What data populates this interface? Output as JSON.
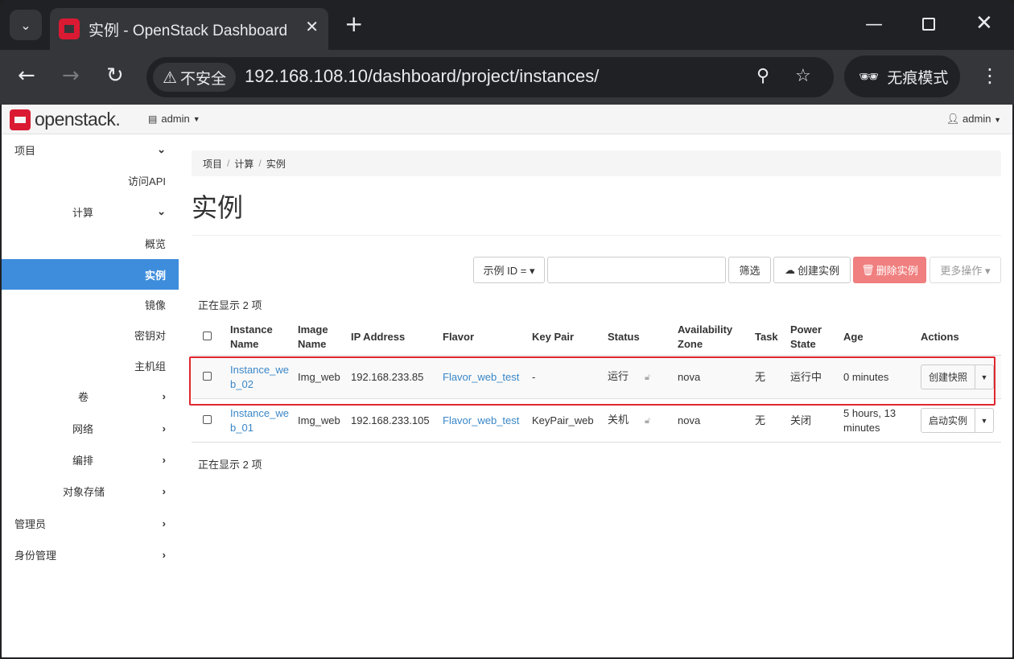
{
  "browser": {
    "tab_title": "实例 - OpenStack Dashboard",
    "security_label": "不安全",
    "url": "192.168.108.10/dashboard/project/instances/",
    "incognito_label": "无痕模式"
  },
  "header": {
    "logo_text": "openstack.",
    "project_label": "admin",
    "user_label": "admin"
  },
  "sidebar": {
    "items": [
      {
        "label": "项目"
      },
      {
        "label": "访问API"
      },
      {
        "label": "计算"
      },
      {
        "label": "概览"
      },
      {
        "label": "实例"
      },
      {
        "label": "镜像"
      },
      {
        "label": "密钥对"
      },
      {
        "label": "主机组"
      },
      {
        "label": "卷"
      },
      {
        "label": "网络"
      },
      {
        "label": "编排"
      },
      {
        "label": "对象存储"
      },
      {
        "label": "管理员"
      },
      {
        "label": "身份管理"
      }
    ]
  },
  "breadcrumb": [
    "项目",
    "计算",
    "实例"
  ],
  "page_title": "实例",
  "toolbar": {
    "filter_select": "示例 ID = ▾",
    "filter_value": "",
    "filter_button": "筛选",
    "create_button": "创建实例",
    "delete_button": "删除实例",
    "more_button": "更多操作 ▾"
  },
  "count_top": "正在显示 2 项",
  "count_bottom": "正在显示 2 项",
  "table": {
    "headers": [
      "Instance Name",
      "Image Name",
      "IP Address",
      "Flavor",
      "Key Pair",
      "Status",
      "Availability Zone",
      "Task",
      "Power State",
      "Age",
      "Actions"
    ],
    "rows": [
      {
        "name": "Instance_web_02",
        "image": "Img_web",
        "ip": "192.168.233.85",
        "flavor": "Flavor_web_test",
        "keypair": "-",
        "status": "运行",
        "zone": "nova",
        "task": "无",
        "power": "运行中",
        "age": "0 minutes",
        "action": "创建快照"
      },
      {
        "name": "Instance_web_01",
        "image": "Img_web",
        "ip": "192.168.233.105",
        "flavor": "Flavor_web_test",
        "keypair": "KeyPair_web",
        "status": "关机",
        "zone": "nova",
        "task": "无",
        "power": "关闭",
        "age": "5 hours, 13 minutes",
        "action": "启动实例"
      }
    ]
  }
}
